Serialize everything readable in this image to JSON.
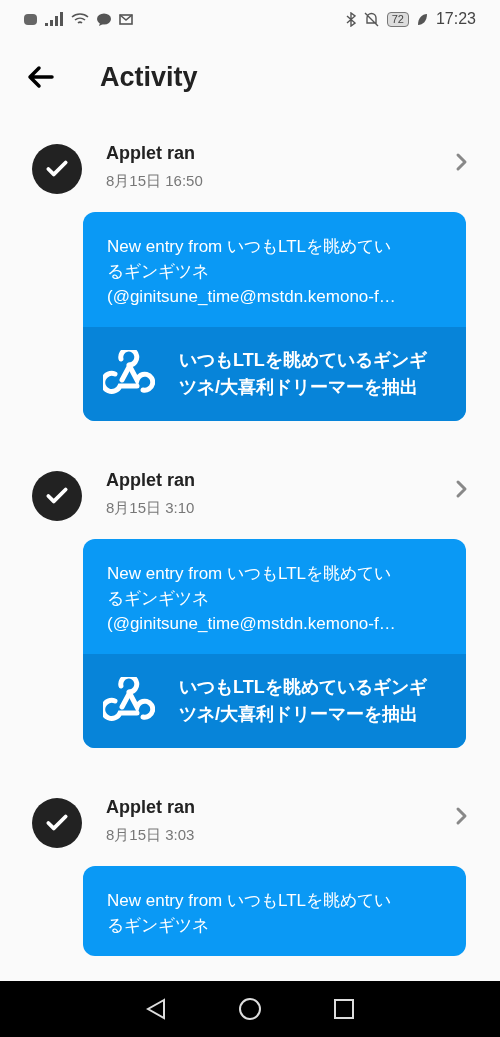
{
  "status_bar": {
    "battery": "72",
    "time": "17:23"
  },
  "header": {
    "title": "Activity"
  },
  "entries": [
    {
      "title": "Applet ran",
      "time": "8月15日 16:50",
      "message_lines": [
        "New entry from いつもLTLを眺めてい",
        "るギンギツネ",
        "(@ginitsune_time@mstdn.kemono-f…"
      ],
      "action_lines": [
        "いつもLTLを眺めているギンギ",
        "ツネ/大喜利ドリーマーを抽出"
      ]
    },
    {
      "title": "Applet ran",
      "time": "8月15日 3:10",
      "message_lines": [
        "New entry from いつもLTLを眺めてい",
        "るギンギツネ",
        "(@ginitsune_time@mstdn.kemono-f…"
      ],
      "action_lines": [
        "いつもLTLを眺めているギンギ",
        "ツネ/大喜利ドリーマーを抽出"
      ]
    },
    {
      "title": "Applet ran",
      "time": "8月15日 3:03",
      "message_lines": [
        "New entry from いつもLTLを眺めてい",
        "るギンギツネ"
      ]
    }
  ]
}
